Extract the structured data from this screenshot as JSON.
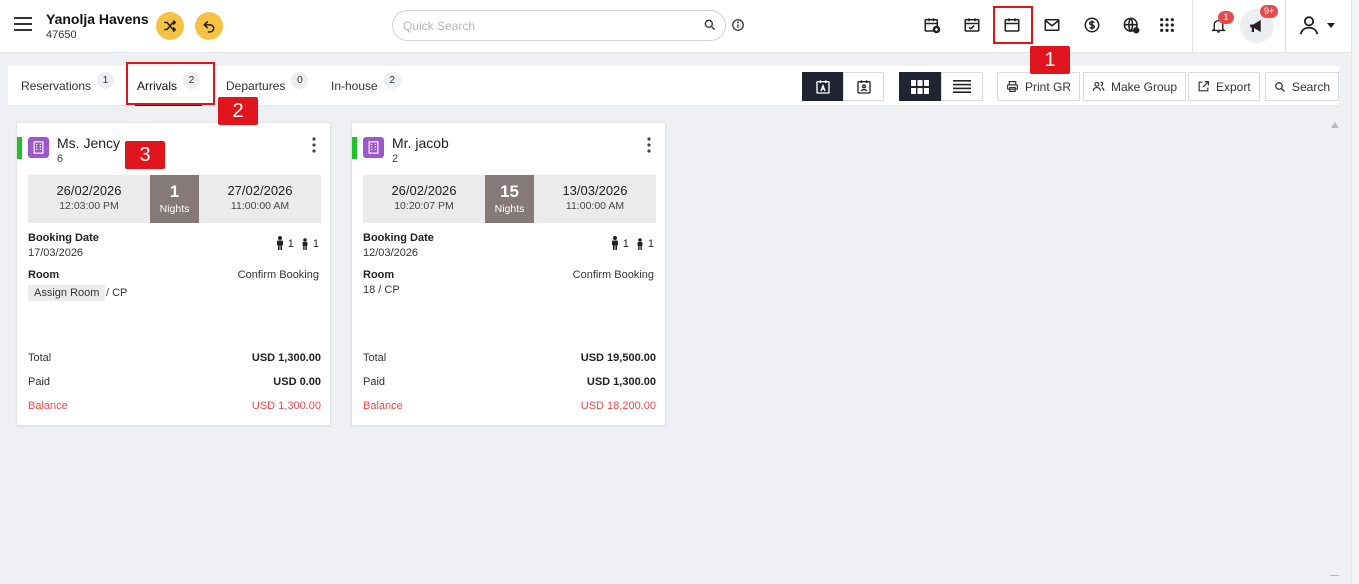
{
  "header": {
    "property_name": "Yanolja Havens",
    "property_code": "47650",
    "search_placeholder": "Quick Search",
    "notifications_count": "1",
    "announcements_count": "9+"
  },
  "icons": {
    "menu": "hamburger-icon",
    "switch": "shuffle-icon",
    "undo": "undo-icon",
    "search": "search-icon",
    "info": "info-icon",
    "toolbar": [
      "calendar-add-icon",
      "calendar-check-icon",
      "calendar-icon",
      "mail-icon",
      "dollar-icon",
      "globe-icon",
      "apps-grid-icon"
    ],
    "bell": "bell-icon",
    "megaphone": "megaphone-icon",
    "user": "user-icon"
  },
  "annotations": [
    "1",
    "2",
    "3"
  ],
  "tabs": [
    {
      "label": "Reservations",
      "count": "1"
    },
    {
      "label": "Arrivals",
      "count": "2"
    },
    {
      "label": "Departures",
      "count": "0"
    },
    {
      "label": "In-house",
      "count": "2"
    }
  ],
  "actions": {
    "print_gr": "Print GR",
    "make_group": "Make Group",
    "export": "Export",
    "search": "Search"
  },
  "cards": [
    {
      "guest": "Ms. Jency",
      "sub": "6",
      "checkin_date": "26/02/2026",
      "checkin_time": "12:03:00 PM",
      "nights": "1",
      "nights_label": "Nights",
      "checkout_date": "27/02/2026",
      "checkout_time": "11:00:00 AM",
      "booking_date_label": "Booking Date",
      "booking_date": "17/03/2026",
      "adults": "1",
      "children": "1",
      "room_label": "Room",
      "status": "Confirm Booking",
      "assign_room": "Assign Room",
      "room_suffix": "/ CP",
      "total_label": "Total",
      "total": "USD 1,300.00",
      "paid_label": "Paid",
      "paid": "USD 0.00",
      "balance_label": "Balance",
      "balance": "USD 1,300.00"
    },
    {
      "guest": "Mr. jacob",
      "sub": "2",
      "checkin_date": "26/02/2026",
      "checkin_time": "10:20:07 PM",
      "nights": "15",
      "nights_label": "Nights",
      "checkout_date": "13/03/2026",
      "checkout_time": "11:00:00 AM",
      "booking_date_label": "Booking Date",
      "booking_date": "12/03/2026",
      "adults": "1",
      "children": "1",
      "room_label": "Room",
      "status": "Confirm Booking",
      "room": "18 / CP",
      "total_label": "Total",
      "total": "USD 19,500.00",
      "paid_label": "Paid",
      "paid": "USD 1,300.00",
      "balance_label": "Balance",
      "balance": "USD 18,200.00"
    }
  ],
  "colors": {
    "accent_yellow": "#f6c244",
    "status_green": "#22c02c",
    "room_purple": "#9b59c8",
    "nights_bg": "#857a78",
    "balance_red": "#e74c4c",
    "annotation_red": "#e0141c"
  }
}
